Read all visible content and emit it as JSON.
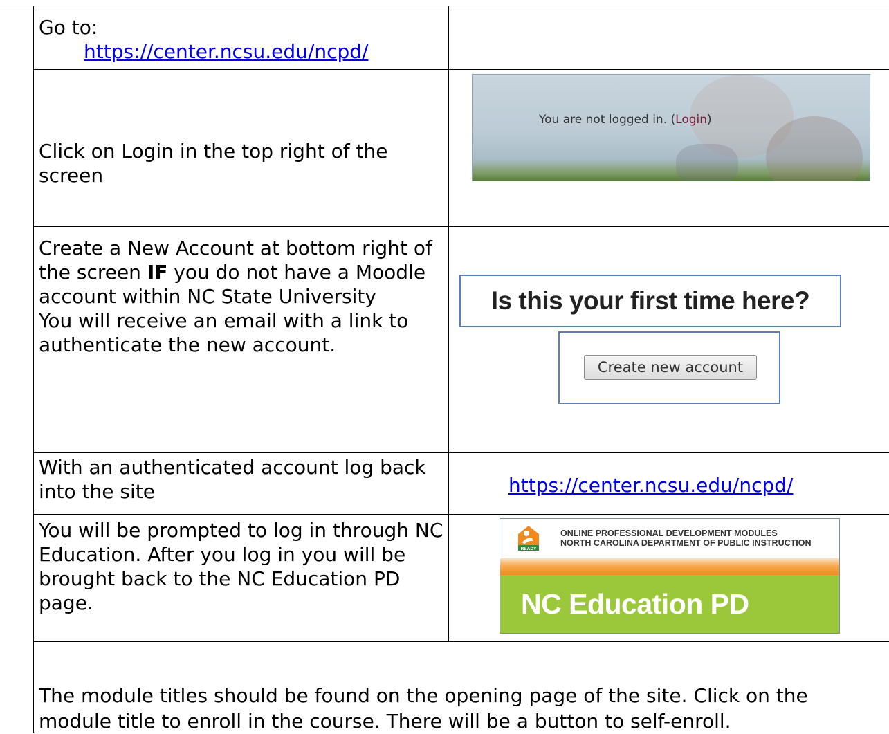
{
  "step1": {
    "goto_label": "Go to:",
    "url": "https://center.ncsu.edu/ncpd/"
  },
  "step2": {
    "instruction": "Click on Login in the top right of the screen",
    "screenshot_text": "You are not logged in. (",
    "screenshot_link": "Login",
    "screenshot_close": ")"
  },
  "step3": {
    "instruction_before": "Create a New Account at bottom right of the screen ",
    "instruction_bold": "IF",
    "instruction_after": " you do not have a Moodle account within NC State University",
    "note": "You will receive an email with a link to authenticate the new account.",
    "first_time_heading": "Is this your first time here?",
    "create_button": "Create new account"
  },
  "step4": {
    "instruction": "With an authenticated account log back into the site",
    "url": "https://center.ncsu.edu/ncpd/"
  },
  "step5": {
    "instruction": "You will be prompted to log in through NC Education.  After you log in you will be brought back to the NC Education PD page.",
    "banner_badge": "READY",
    "banner_org_line1": "ONLINE PROFESSIONAL DEVELOPMENT MODULES",
    "banner_org_line2": "NORTH CAROLINA DEPARTMENT OF PUBLIC INSTRUCTION",
    "banner_title": "NC Education PD"
  },
  "footer": {
    "text": "The module titles should be found on the opening page of the site.  Click on the module title to enroll in the course.  There will be a button to self-enroll."
  },
  "colors": {
    "link": "#0000ee",
    "banner_green": "#9bc83a",
    "banner_orange": "#f08a1c",
    "box_border": "#5b7fb8"
  }
}
